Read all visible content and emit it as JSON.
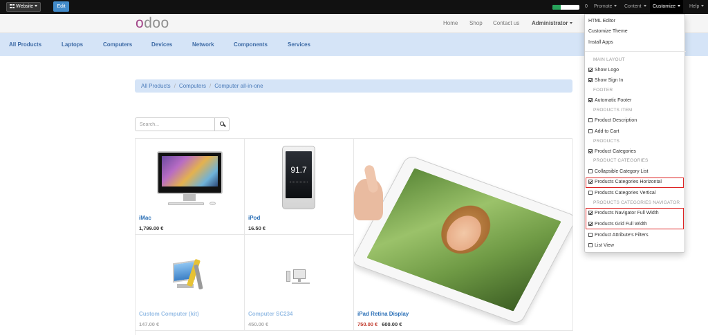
{
  "topbar": {
    "website_label": "Website",
    "edit_label": "Edit",
    "progress_fraction": 0.3,
    "count": "0",
    "menus": [
      {
        "label": "Promote"
      },
      {
        "label": "Content"
      },
      {
        "label": "Customize"
      },
      {
        "label": "Help"
      }
    ]
  },
  "header": {
    "logo_first": "o",
    "logo_rest": "doo",
    "nav": [
      {
        "label": "Home"
      },
      {
        "label": "Shop"
      },
      {
        "label": "Contact us"
      },
      {
        "label": "Administrator"
      }
    ]
  },
  "categories": [
    "All Products",
    "Laptops",
    "Computers",
    "Devices",
    "Network",
    "Components",
    "Services"
  ],
  "breadcrumb": [
    "All Products",
    "Computers",
    "Computer all-in-one"
  ],
  "search": {
    "placeholder": "Search..."
  },
  "products": [
    {
      "name": "iMac",
      "price": "1,799.00 €"
    },
    {
      "name": "iPod",
      "price": "16.50 €"
    },
    {
      "name": "iPad Retina Display",
      "old_price": "750.00 €",
      "price": "600.00 €"
    },
    {
      "name": "Custom Computer (kit)",
      "price": "147.00 €"
    },
    {
      "name": "Computer SC234",
      "price": "450.00 €"
    }
  ],
  "ipod_screen": "91.7",
  "customize_menu": {
    "top_items": [
      "HTML Editor",
      "Customize Theme",
      "Install Apps"
    ],
    "sections": {
      "main_layout": "MAIN LAYOUT",
      "footer": "FOOTER",
      "products_item": "PRODUCTS ITEM",
      "products": "PRODUCTS",
      "product_categories": "PRODUCT CATEGORIES",
      "products_categories_navigator": "PRODUCTS CATEGORIES NAVIGATOR"
    },
    "options": {
      "show_logo": {
        "label": "Show Logo",
        "checked": true
      },
      "show_sign_in": {
        "label": "Show Sign In",
        "checked": true
      },
      "automatic_footer": {
        "label": "Automatic Footer",
        "checked": true
      },
      "product_description": {
        "label": "Product Description",
        "checked": false
      },
      "add_to_cart": {
        "label": "Add to Cart",
        "checked": false
      },
      "product_categories": {
        "label": "Product Categories",
        "checked": true
      },
      "collapsible_category_list": {
        "label": "Collapsible Category List",
        "checked": false
      },
      "products_categories_horizontal": {
        "label": "Products Categories Horizontal",
        "checked": true
      },
      "products_categories_vertical": {
        "label": "Products Categories Vertical",
        "checked": false
      },
      "products_navigator_full_width": {
        "label": "Products Navigator Full Width",
        "checked": true
      },
      "products_grid_full_width": {
        "label": "Products Grid Full Width",
        "checked": true
      },
      "product_attributes_filters": {
        "label": "Product Attribute's Filters",
        "checked": false
      },
      "list_view": {
        "label": "List View",
        "checked": false
      }
    }
  },
  "colors": {
    "accent": "#428bca",
    "category_bar": "#d5e4f7",
    "link": "#2a6fb6",
    "logo_primary": "#a24689",
    "highlight": "#dd2222",
    "old_price": "#c0392b"
  }
}
